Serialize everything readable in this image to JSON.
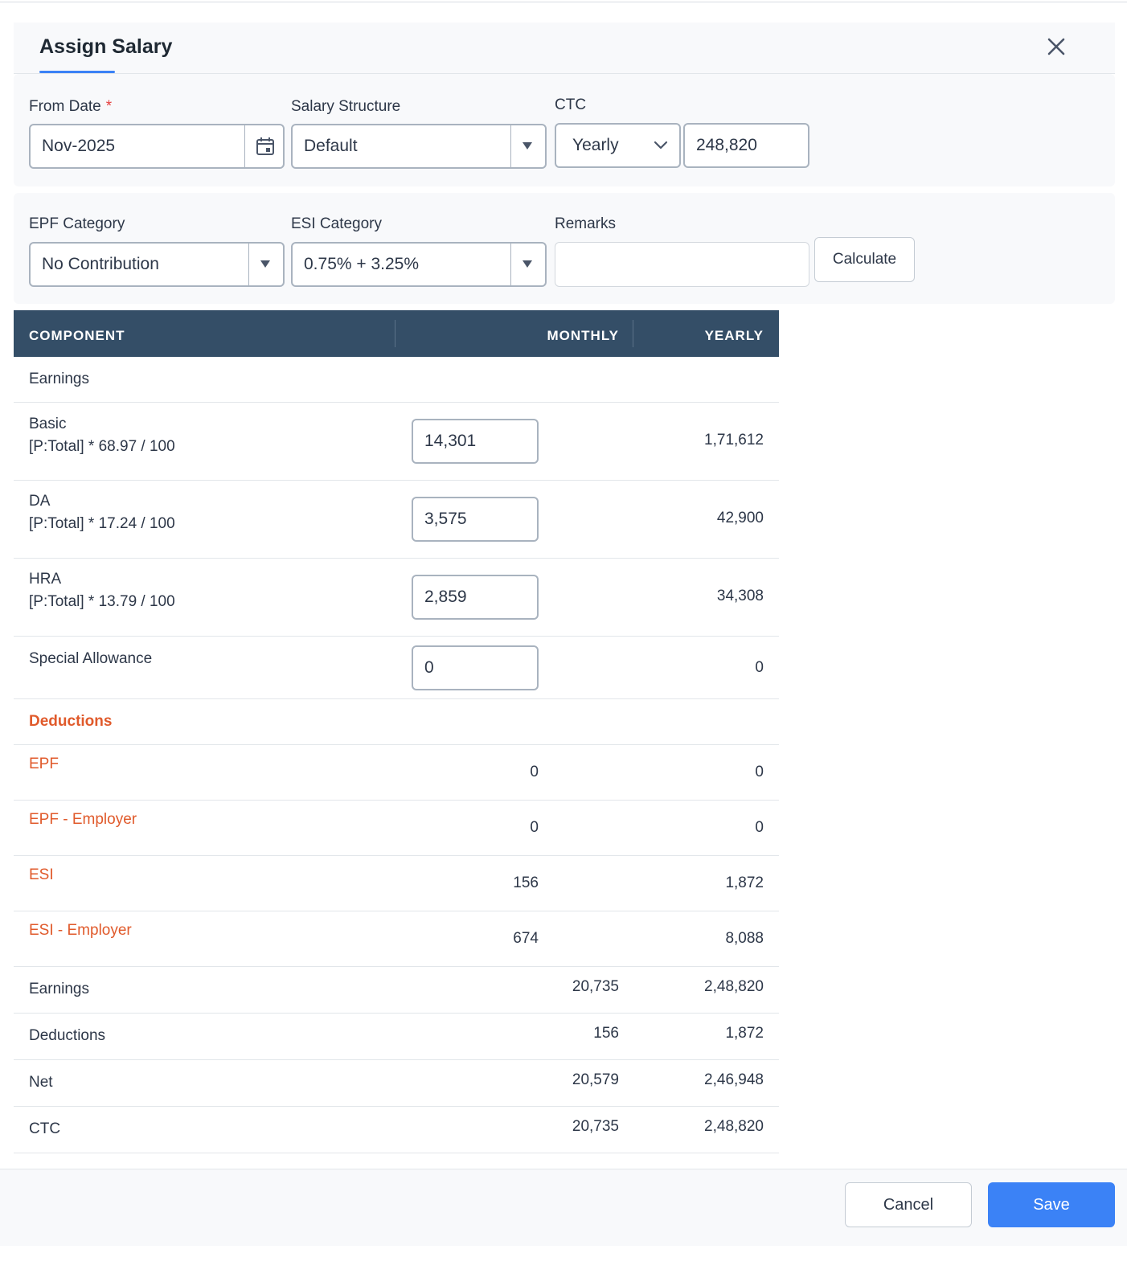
{
  "dialog": {
    "title": "Assign Salary"
  },
  "form": {
    "from_date": {
      "label": "From Date",
      "required_mark": "*",
      "value": "Nov-2025"
    },
    "salary_structure": {
      "label": "Salary Structure",
      "value": "Default"
    },
    "ctc": {
      "label": "CTC",
      "period": "Yearly",
      "amount": "248,820"
    },
    "epf_category": {
      "label": "EPF Category",
      "value": "No Contribution"
    },
    "esi_category": {
      "label": "ESI Category",
      "value": "0.75% + 3.25%"
    },
    "remarks": {
      "label": "Remarks",
      "value": ""
    },
    "calculate_label": "Calculate"
  },
  "table": {
    "headers": {
      "component": "COMPONENT",
      "monthly": "MONTHLY",
      "yearly": "YEARLY"
    },
    "earnings_heading": "Earnings",
    "earnings": [
      {
        "name": "Basic",
        "formula": "[P:Total] * 68.97 / 100",
        "monthly": "14,301",
        "yearly": "1,71,612"
      },
      {
        "name": "DA",
        "formula": "[P:Total] * 17.24 / 100",
        "monthly": "3,575",
        "yearly": "42,900"
      },
      {
        "name": "HRA",
        "formula": "[P:Total] * 13.79 / 100",
        "monthly": "2,859",
        "yearly": "34,308"
      },
      {
        "name": "Special Allowance",
        "formula": "",
        "monthly": "0",
        "yearly": "0"
      }
    ],
    "deductions_heading": "Deductions",
    "deductions": [
      {
        "name": "EPF",
        "monthly": "0",
        "yearly": "0"
      },
      {
        "name": "EPF - Employer",
        "monthly": "0",
        "yearly": "0"
      },
      {
        "name": "ESI",
        "monthly": "156",
        "yearly": "1,872"
      },
      {
        "name": "ESI - Employer",
        "monthly": "674",
        "yearly": "8,088"
      }
    ],
    "totals": [
      {
        "name": "Earnings",
        "monthly": "20,735",
        "yearly": "2,48,820"
      },
      {
        "name": "Deductions",
        "monthly": "156",
        "yearly": "1,872"
      },
      {
        "name": "Net",
        "monthly": "20,579",
        "yearly": "2,46,948"
      },
      {
        "name": "CTC",
        "monthly": "20,735",
        "yearly": "2,48,820"
      }
    ]
  },
  "footer": {
    "cancel_label": "Cancel",
    "save_label": "Save"
  },
  "colors": {
    "header_bg": "#344e67",
    "accent": "#3b82f6",
    "deduction": "#e05a2b",
    "required": "#e53e3e"
  },
  "icons": {
    "close": "close-icon",
    "calendar": "calendar-icon",
    "dropdown": "caret-down-icon",
    "chevron": "chevron-down-icon"
  }
}
